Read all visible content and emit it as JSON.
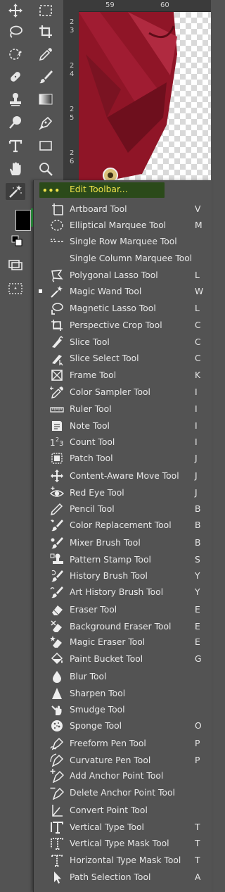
{
  "ruler": {
    "top_labels": [
      "59",
      "60"
    ],
    "left_labels": [
      "2",
      "3",
      "2",
      "4",
      "2",
      "5",
      "2",
      "6"
    ]
  },
  "edit_toolbar": {
    "dots": "•••",
    "label": "Edit Toolbar..."
  },
  "menu_items": [
    {
      "label": "Artboard Tool",
      "key": "V",
      "icon": "artboard-icon",
      "active": false
    },
    {
      "label": "Elliptical Marquee Tool",
      "key": "M",
      "icon": "elliptical-marquee-icon",
      "active": false
    },
    {
      "label": "Single Row Marquee Tool",
      "key": "",
      "icon": "single-row-marquee-icon",
      "active": false
    },
    {
      "label": "Single Column Marquee Tool",
      "key": "",
      "icon": "single-column-marquee-icon",
      "active": false
    },
    {
      "label": "Polygonal Lasso Tool",
      "key": "L",
      "icon": "polygonal-lasso-icon",
      "active": false
    },
    {
      "label": "Magic Wand Tool",
      "key": "W",
      "icon": "magic-wand-icon",
      "active": true
    },
    {
      "label": "Magnetic Lasso Tool",
      "key": "L",
      "icon": "magnetic-lasso-icon",
      "active": false
    },
    {
      "label": "Perspective Crop Tool",
      "key": "C",
      "icon": "perspective-crop-icon",
      "active": false
    },
    {
      "label": "Slice Tool",
      "key": "C",
      "icon": "slice-icon",
      "active": false
    },
    {
      "label": "Slice Select Tool",
      "key": "C",
      "icon": "slice-select-icon",
      "active": false
    },
    {
      "label": "Frame Tool",
      "key": "K",
      "icon": "frame-icon",
      "active": false
    },
    {
      "label": "Color Sampler Tool",
      "key": "I",
      "icon": "color-sampler-icon",
      "active": false
    },
    {
      "label": "Ruler Tool",
      "key": "I",
      "icon": "ruler-icon",
      "active": false
    },
    {
      "label": "Note Tool",
      "key": "I",
      "icon": "note-icon",
      "active": false
    },
    {
      "label": "Count Tool",
      "key": "I",
      "icon": "count-icon",
      "active": false
    },
    {
      "label": "Patch Tool",
      "key": "J",
      "icon": "patch-icon",
      "active": false
    },
    {
      "label": "Content-Aware Move Tool",
      "key": "J",
      "icon": "content-aware-move-icon",
      "active": false
    },
    {
      "label": "Red Eye Tool",
      "key": "J",
      "icon": "red-eye-icon",
      "active": false
    },
    {
      "label": "Pencil Tool",
      "key": "B",
      "icon": "pencil-icon",
      "active": false
    },
    {
      "label": "Color Replacement Tool",
      "key": "B",
      "icon": "color-replacement-icon",
      "active": false
    },
    {
      "label": "Mixer Brush Tool",
      "key": "B",
      "icon": "mixer-brush-icon",
      "active": false
    },
    {
      "label": "Pattern Stamp Tool",
      "key": "S",
      "icon": "pattern-stamp-icon",
      "active": false
    },
    {
      "label": "History Brush Tool",
      "key": "Y",
      "icon": "history-brush-icon",
      "active": false
    },
    {
      "label": "Art History Brush Tool",
      "key": "Y",
      "icon": "art-history-brush-icon",
      "active": false
    },
    {
      "label": "Eraser Tool",
      "key": "E",
      "icon": "eraser-icon",
      "active": false
    },
    {
      "label": "Background Eraser Tool",
      "key": "E",
      "icon": "background-eraser-icon",
      "active": false
    },
    {
      "label": "Magic Eraser Tool",
      "key": "E",
      "icon": "magic-eraser-icon",
      "active": false
    },
    {
      "label": "Paint Bucket Tool",
      "key": "G",
      "icon": "paint-bucket-icon",
      "active": false
    },
    {
      "label": "Blur Tool",
      "key": "",
      "icon": "blur-icon",
      "active": false
    },
    {
      "label": "Sharpen Tool",
      "key": "",
      "icon": "sharpen-icon",
      "active": false
    },
    {
      "label": "Smudge Tool",
      "key": "",
      "icon": "smudge-icon",
      "active": false
    },
    {
      "label": "Sponge Tool",
      "key": "O",
      "icon": "sponge-icon",
      "active": false
    },
    {
      "label": "Freeform Pen Tool",
      "key": "P",
      "icon": "freeform-pen-icon",
      "active": false
    },
    {
      "label": "Curvature Pen Tool",
      "key": "P",
      "icon": "curvature-pen-icon",
      "active": false
    },
    {
      "label": "Add Anchor Point Tool",
      "key": "",
      "icon": "add-anchor-point-icon",
      "active": false
    },
    {
      "label": "Delete Anchor Point Tool",
      "key": "",
      "icon": "delete-anchor-point-icon",
      "active": false
    },
    {
      "label": "Convert Point Tool",
      "key": "",
      "icon": "convert-point-icon",
      "active": false
    },
    {
      "label": "Vertical Type Tool",
      "key": "T",
      "icon": "vertical-type-icon",
      "active": false
    },
    {
      "label": "Vertical Type Mask Tool",
      "key": "T",
      "icon": "vertical-type-mask-icon",
      "active": false
    },
    {
      "label": "Horizontal Type Mask Tool",
      "key": "T",
      "icon": "horizontal-type-mask-icon",
      "active": false
    },
    {
      "label": "Path Selection Tool",
      "key": "A",
      "icon": "path-selection-icon",
      "active": false
    }
  ],
  "colors": {
    "accent_text": "#f0e44a",
    "menu_bg": "#535353",
    "canvas_red": "#8f1527"
  }
}
